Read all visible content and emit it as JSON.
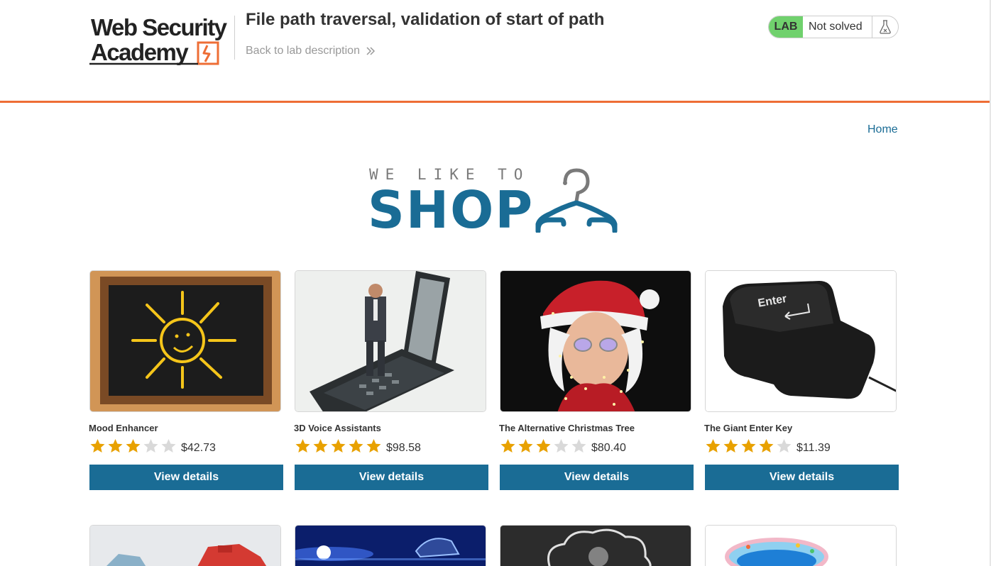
{
  "header": {
    "logo_text_line1": "Web Security",
    "logo_text_line2": "Academy",
    "lab_title": "File path traversal, validation of start of path",
    "back_link": "Back to lab description",
    "lab_badge": "LAB",
    "lab_status": "Not solved"
  },
  "nav": {
    "home": "Home"
  },
  "banner": {
    "small": "WE LIKE TO",
    "big": "SHOP"
  },
  "colors": {
    "accent": "#1a6c95",
    "header_rule": "#ee6e35",
    "badge": "#70d16d",
    "star": "#e8a100",
    "star_empty": "#d9d9d9"
  },
  "products": [
    {
      "name": "Mood Enhancer",
      "rating": 3,
      "price": "$42.73",
      "button": "View details",
      "image": "chalkboard-sun-image"
    },
    {
      "name": "3D Voice Assistants",
      "rating": 5,
      "price": "$98.58",
      "button": "View details",
      "image": "phone-figure-image"
    },
    {
      "name": "The Alternative Christmas Tree",
      "rating": 3,
      "price": "$80.40",
      "button": "View details",
      "image": "santa-lights-image"
    },
    {
      "name": "The Giant Enter Key",
      "rating": 4,
      "price": "$11.39",
      "button": "View details",
      "image": "enter-key-image"
    }
  ],
  "products_row2": [
    {
      "image": "cars-image"
    },
    {
      "image": "lights-speed-image"
    },
    {
      "image": "chalk-cloud-image"
    },
    {
      "image": "paddling-pool-image"
    }
  ]
}
